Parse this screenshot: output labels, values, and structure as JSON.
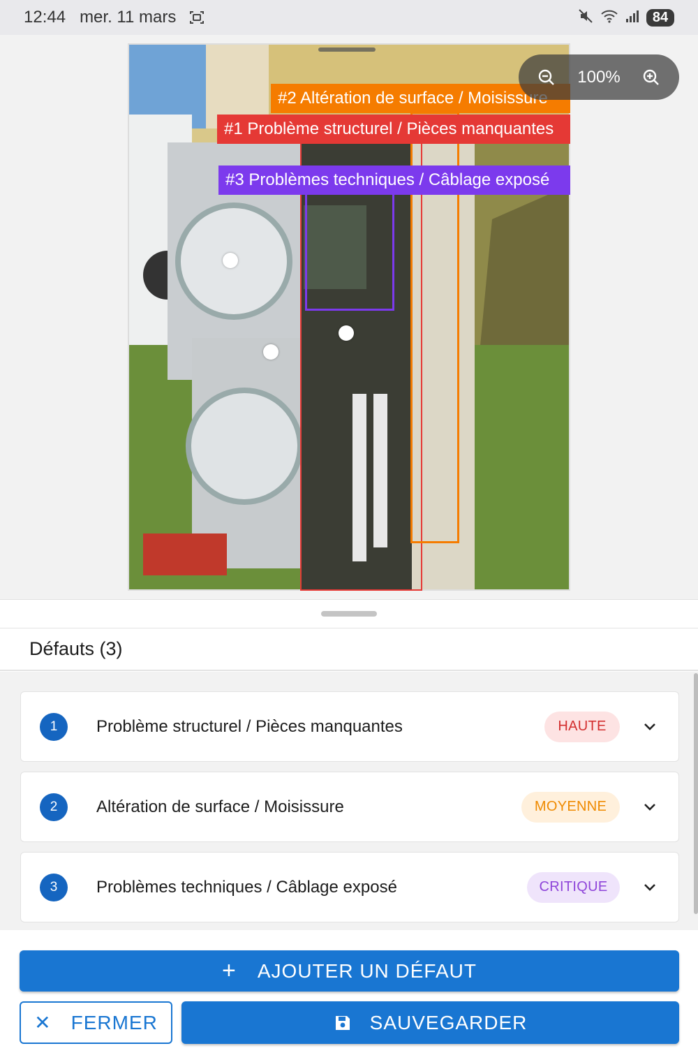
{
  "status_bar": {
    "time": "12:44",
    "date": "mer. 11 mars",
    "battery": "84"
  },
  "viewer": {
    "zoom_level": "100%",
    "zoom_out_icon": "zoom-out-icon",
    "zoom_in_icon": "zoom-in-icon",
    "annotations": [
      {
        "label": "#2 Altération de surface / Moisissure",
        "color": "#f57c00"
      },
      {
        "label": "#1 Problème structurel / Pièces manquantes",
        "color": "#e53935"
      },
      {
        "label": "#3 Problèmes techniques / Câblage exposé",
        "color": "#7c3aed"
      }
    ]
  },
  "sheet": {
    "title": "Défauts (3)",
    "defects": [
      {
        "number": "1",
        "title": "Problème structurel / Pièces manquantes",
        "severity": "HAUTE",
        "severity_bg": "#fde3e3",
        "severity_fg": "#d32f2f"
      },
      {
        "number": "2",
        "title": "Altération de surface / Moisissure",
        "severity": "MOYENNE",
        "severity_bg": "#fff0dc",
        "severity_fg": "#ef8a00"
      },
      {
        "number": "3",
        "title": "Problèmes techniques / Câblage exposé",
        "severity": "CRITIQUE",
        "severity_bg": "#efe4fb",
        "severity_fg": "#8e44d9"
      }
    ]
  },
  "footer": {
    "add_label": "AJOUTER UN DÉFAUT",
    "close_label": "FERMER",
    "save_label": "SAUVEGARDER"
  },
  "colors": {
    "primary": "#1976d2",
    "number_badge": "#1565c0"
  }
}
